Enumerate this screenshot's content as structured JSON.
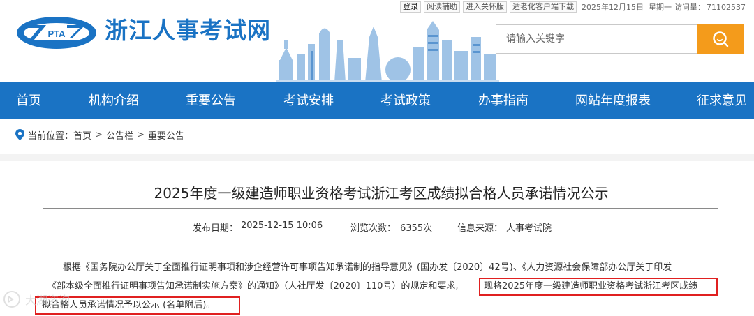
{
  "topbar": {
    "login": "登录",
    "read_assist": "阅读辅助",
    "care_version": "进入关怀版",
    "senior_app": "适老化客户端下载",
    "date": "2025年12月15日",
    "weekday": "星期一",
    "visits_label": "访问量：",
    "visits_value": "71102537"
  },
  "header": {
    "logo_text": "PTA",
    "site_title": "浙江人事考试网"
  },
  "search": {
    "placeholder": "请输入关键字"
  },
  "nav": {
    "items": [
      "首页",
      "机构介绍",
      "重要公告",
      "考试安排",
      "考试政策",
      "办事指南",
      "网站年度报表",
      "征求意见"
    ]
  },
  "breadcrumb": {
    "label": "当前位置：",
    "items": [
      "首页",
      "公告栏",
      "重要公告"
    ],
    "separator": ">"
  },
  "article": {
    "title": "2025年度一级建造师职业资格考试浙江考区成绩拟合格人员承诺情况公示",
    "publish_label": "发布日期：",
    "publish_value": "2025-12-15 10:06",
    "views_label": "浏览次数：",
    "views_value": "6355次",
    "source_label": "信息来源：",
    "source_value": "人事考试院",
    "lines": [
      "根据《国务院办公厅关于全面推行证明事项和涉企经营许可事项告知承诺制的指导意见》(国办发〔2020〕42号)、《人力资源社会保障部办公厅关于印发",
      "《部本级全面推行证明事项告知承诺制实施方案》的通知》（人社厅发〔2020〕110号）的规定和要求,",
      "现将2025年度一级建造师职业资格考试浙江考区成绩",
      "拟合格人员承诺情况予以公示 (名单附后)。"
    ]
  },
  "watermark": {
    "text": "大湖咨询"
  },
  "colors": {
    "brand_blue": "#1a73c4",
    "search_orange": "#f49b1b",
    "highlight_red": "#e02020"
  }
}
